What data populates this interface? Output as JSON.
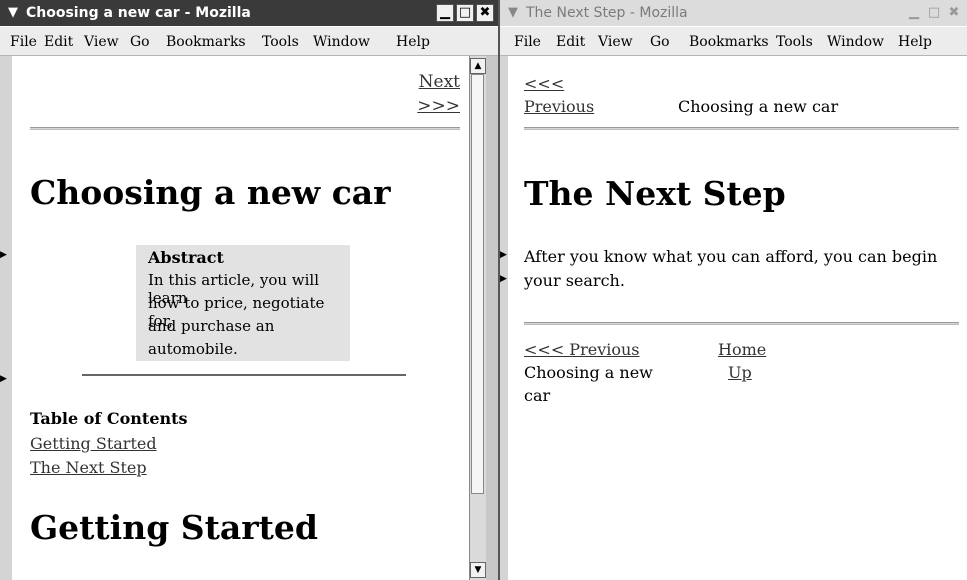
{
  "left": {
    "title": "Choosing a new car - Mozilla",
    "menu": [
      "File",
      "Edit",
      "View",
      "Go",
      "Bookmarks",
      "Tools",
      "Window",
      "Help"
    ],
    "nav_next_1": "Next",
    "nav_next_2": ">>>",
    "heading": "Choosing a new car",
    "abstract_title": "Abstract",
    "abstract_lines": [
      "In this article, you will learn",
      "how to price, negotiate for,",
      "and purchase an",
      "automobile."
    ],
    "toc_title": "Table of Contents",
    "toc_items": [
      "Getting Started",
      "The Next Step"
    ],
    "section_heading": "Getting Started"
  },
  "right": {
    "title": "The Next Step - Mozilla",
    "menu": [
      "File",
      "Edit",
      "View",
      "Go",
      "Bookmarks",
      "Tools",
      "Window",
      "Help"
    ],
    "prev_1": "<<<",
    "prev_2": "Previous",
    "header_center": "Choosing a new car",
    "heading": "The Next Step",
    "body_line_1": "After you know what you can afford, you can begin",
    "body_line_2": "your search.",
    "footer_prev": "<<< Previous",
    "footer_home": "Home",
    "footer_prev_title_1": "Choosing a new",
    "footer_prev_title_2": "car",
    "footer_up": "Up"
  }
}
